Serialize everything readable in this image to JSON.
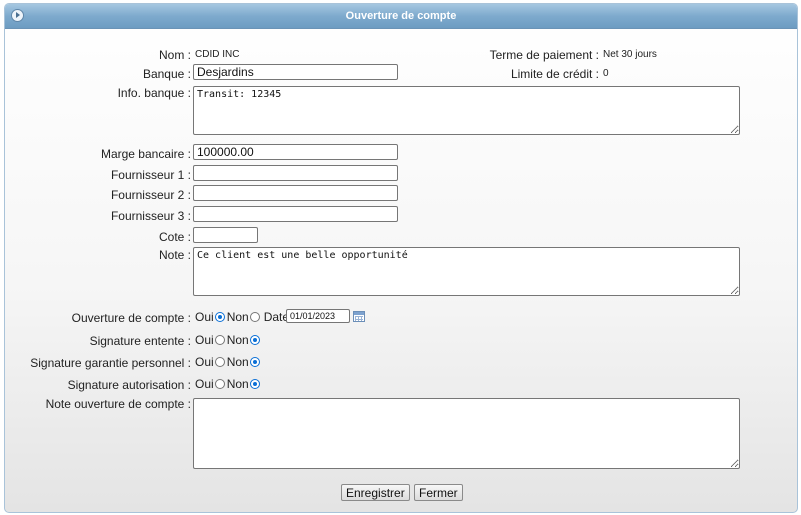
{
  "window": {
    "title": "Ouverture de compte"
  },
  "fields": {
    "nom_label": "Nom :",
    "nom_value": "CDID INC",
    "terme_label": "Terme de paiement :",
    "terme_value": "Net 30 jours",
    "banque_label": "Banque :",
    "banque_value": "Desjardins",
    "limite_label": "Limite de crédit :",
    "limite_value": "0",
    "info_label": "Info. banque :",
    "info_value": "Transit: 12345",
    "marge_label": "Marge bancaire :",
    "marge_value": "100000.00",
    "f1_label": "Fournisseur 1 :",
    "f1_value": "",
    "f2_label": "Fournisseur 2 :",
    "f2_value": "",
    "f3_label": "Fournisseur 3 :",
    "f3_value": "",
    "cote_label": "Cote :",
    "cote_value": "",
    "note_label": "Note :",
    "note_value": "Ce client est une belle opportunité"
  },
  "radios": {
    "oui": "Oui",
    "non": "Non",
    "ouverture_label": "Ouverture de compte :",
    "ouverture_selected": "oui",
    "date_label": "Date :",
    "date_value": "01/01/2023",
    "entente_label": "Signature entente :",
    "entente_selected": "non",
    "garantie_label": "Signature garantie personnel :",
    "garantie_selected": "non",
    "autorisation_label": "Signature autorisation :",
    "autorisation_selected": "non"
  },
  "note_ouverture": {
    "label": "Note ouverture de compte :",
    "value": ""
  },
  "buttons": {
    "save": "Enregistrer",
    "close": "Fermer"
  },
  "icons": {
    "collapse": "circle-arrow-right-icon",
    "calendar": "calendar-icon"
  }
}
